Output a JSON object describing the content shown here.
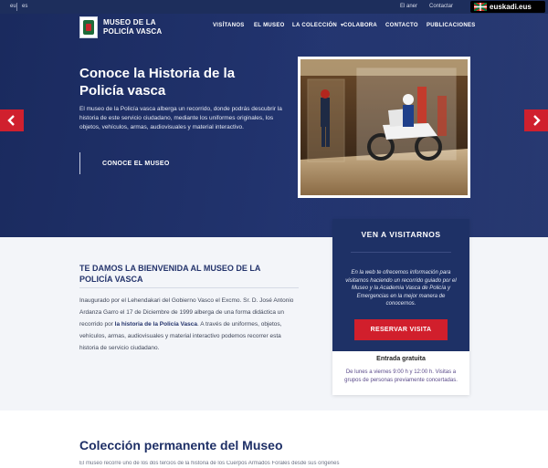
{
  "topbar": {
    "lang_eu": "eu",
    "lang_es": "es",
    "link_1": "El aner",
    "link_2": "Contactar",
    "euskadi": "euskadi.eus"
  },
  "header": {
    "logo_line1": "MUSEO DE LA",
    "logo_line2": "POLICÍA VASCA",
    "nav": [
      "VISÍTANOS",
      "EL MUSEO",
      "LA COLECCIÓN",
      "COLABORA",
      "CONTACTO",
      "PUBLICACIONES"
    ]
  },
  "hero": {
    "title": "Conoce la Historia de la Policía vasca",
    "description": "El museo de la Policía vasca alberga un recorrido, donde podrás descubrir la historia de este servicio ciudadano, mediante los uniformes originales, los objetos, vehículos, armas, audiovisuales y material interactivo.",
    "cta": "CONOCE EL MUSEO"
  },
  "welcome": {
    "title": "TE DAMOS LA BIENVENIDA AL MUSEO DE LA POLICÍA VASCA",
    "text_part1": "Inaugurado por el Lehendakari del Gobierno Vasco el Excmo. Sr. D. José Antonio Ardanza Garro el 17 de Diciembre de 1999 alberga de una forma didáctica un recorrido por ",
    "text_strong": "la historia de la Policía Vasca",
    "text_part2": ". A través de uniformes, objetos, vehículos, armas, audiovisuales y material interactivo podemos recorrer esta historia de servicio ciudadano."
  },
  "visit": {
    "title": "VEN A VISITARNOS",
    "description": "En la web te ofrecemos información para visitarnos haciendo un recorrido guiado por el Museo y la Academia Vasca de Policía y Emergencias en la mejor manera de conocernos.",
    "button": "RESERVAR VISITA",
    "free": "Entrada gratuita",
    "hours": "De lunes a viernes 9:00 h y 12:00 h. Visitas a grupos de personas previamente concertadas."
  },
  "collection": {
    "title": "Colección permanente del Museo",
    "text": "El museo recorre uno de los dos tercios de la historia de los Cuerpos Armados Forales desde sus orígenes"
  }
}
